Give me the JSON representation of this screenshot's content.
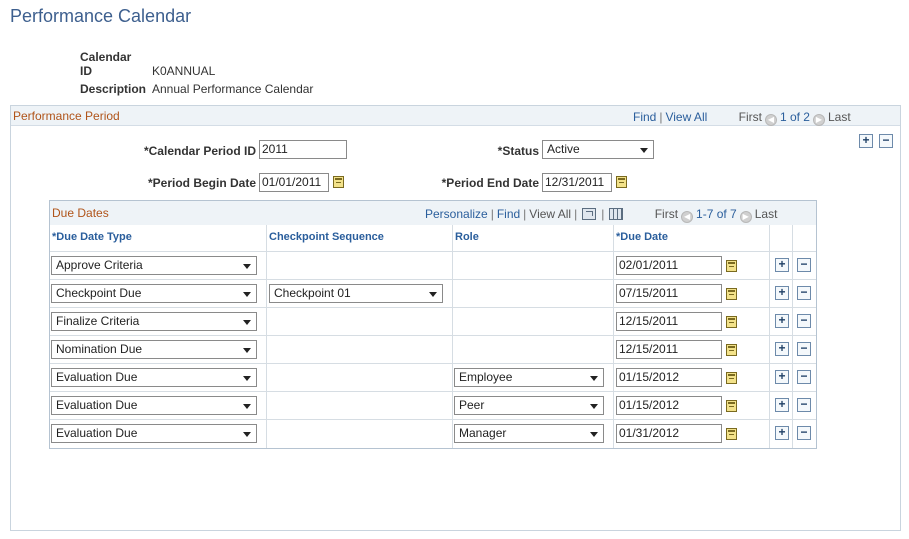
{
  "page": {
    "title": "Performance Calendar"
  },
  "header": {
    "calendar_id_label": "Calendar ID",
    "calendar_id_value": "K0ANNUAL",
    "description_label": "Description",
    "description_value": "Annual Performance Calendar"
  },
  "period": {
    "title": "Performance Period",
    "nav": {
      "find": "Find",
      "view_all": "View All",
      "first": "First",
      "counter": "1 of 2",
      "last": "Last"
    },
    "calendar_period_id_label": "*Calendar Period ID",
    "calendar_period_id_value": "2011",
    "status_label": "*Status",
    "status_value": "Active",
    "begin_date_label": "*Period Begin Date",
    "begin_date_value": "01/01/2011",
    "end_date_label": "*Period End Date",
    "end_date_value": "12/31/2011"
  },
  "due_dates": {
    "title": "Due Dates",
    "nav": {
      "personalize": "Personalize",
      "find": "Find",
      "view_all": "View All",
      "first": "First",
      "counter": "1-7 of 7",
      "last": "Last"
    },
    "columns": {
      "type": "*Due Date Type",
      "checkpoint": "Checkpoint Sequence",
      "role": "Role",
      "due_date": "*Due Date"
    },
    "rows": [
      {
        "type": "Approve Criteria",
        "checkpoint": "",
        "role": "",
        "due_date": "02/01/2011"
      },
      {
        "type": "Checkpoint Due",
        "checkpoint": "Checkpoint 01",
        "role": "",
        "due_date": "07/15/2011"
      },
      {
        "type": "Finalize Criteria",
        "checkpoint": "",
        "role": "",
        "due_date": "12/15/2011"
      },
      {
        "type": "Nomination Due",
        "checkpoint": "",
        "role": "",
        "due_date": "12/15/2011"
      },
      {
        "type": "Evaluation Due",
        "checkpoint": "",
        "role": "Employee",
        "due_date": "01/15/2012"
      },
      {
        "type": "Evaluation Due",
        "checkpoint": "",
        "role": "Peer",
        "due_date": "01/15/2012"
      },
      {
        "type": "Evaluation Due",
        "checkpoint": "",
        "role": "Manager",
        "due_date": "01/31/2012"
      }
    ]
  },
  "icons": {
    "add": "+",
    "remove": "−",
    "prev": "◀",
    "next": "▶"
  }
}
